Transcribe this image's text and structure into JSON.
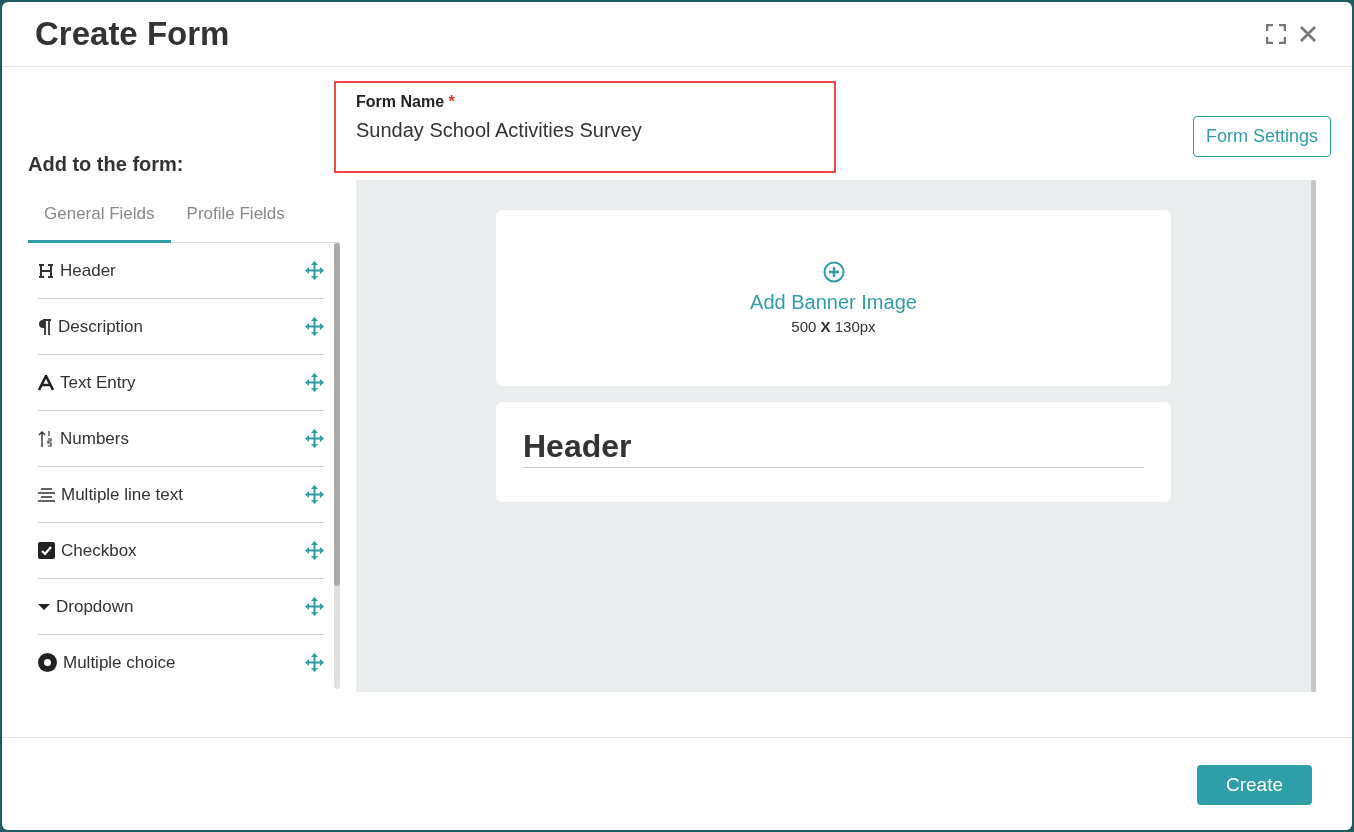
{
  "window": {
    "title": "Create Form"
  },
  "form_name": {
    "label": "Form Name",
    "required_mark": "*",
    "value": "Sunday School Activities Survey"
  },
  "form_settings_button": "Form Settings",
  "sidebar": {
    "title": "Add to the form:",
    "tabs": [
      {
        "label": "General Fields",
        "selected": true
      },
      {
        "label": "Profile Fields",
        "selected": false
      }
    ],
    "items": [
      {
        "label": "Header",
        "kind": "header"
      },
      {
        "label": "Description",
        "kind": "paragraph"
      },
      {
        "label": "Text Entry",
        "kind": "text"
      },
      {
        "label": "Numbers",
        "kind": "numbers"
      },
      {
        "label": "Multiple line text",
        "kind": "multiline"
      },
      {
        "label": "Checkbox",
        "kind": "checkbox"
      },
      {
        "label": "Dropdown",
        "kind": "dropdown"
      },
      {
        "label": "Multiple choice",
        "kind": "radio"
      }
    ]
  },
  "canvas": {
    "banner": {
      "label": "Add Banner Image",
      "size": "500 **X** 130px"
    },
    "header_block": {
      "text": "Header"
    }
  },
  "footer": {
    "create_button": "Create"
  }
}
